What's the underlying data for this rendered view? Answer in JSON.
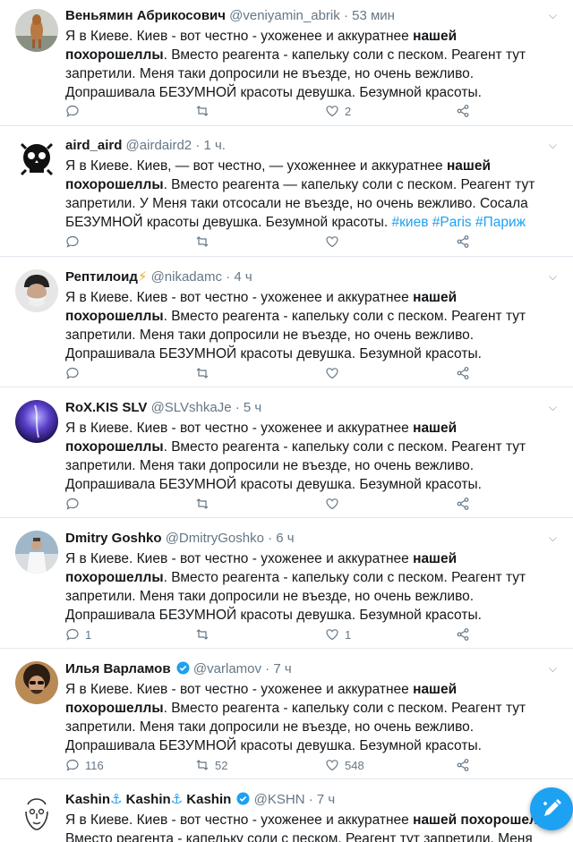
{
  "colors": {
    "accent": "#1da1f2",
    "text": "#14171a",
    "muted": "#657786",
    "divider": "#e1e8ed"
  },
  "tweets": [
    {
      "name": "Веньямин Абрикосович",
      "handle": "@veniyamin_abrik",
      "time": "53 мин",
      "avatar": "dog-avatar",
      "t1": "Я в Киеве. Киев - вот честно - ухоженее и аккуратнее ",
      "t1b": "нашей похорошеллы",
      "t1c": ".",
      "t2": "Вместо реагента - капельку соли с песком. Реагент тут запретили. Меня таки допросили не въезде, но очень вежливо. Допрашивала БЕЗУМНОЙ красоты девушка. Безумной красоты.",
      "replies": "",
      "retweets": "",
      "likes": "2"
    },
    {
      "name": "aird_aird",
      "handle": "@airdaird2",
      "time": "1 ч.",
      "avatar": "skull-avatar",
      "t1": "Я в Киеве. Киев, — вот честно, — ухоженнее и аккуратнее ",
      "t1b": "нашей похорошеллы",
      "t1c": ".",
      "t2": " Вместо реагента — капельку соли с песком. Реагент тут запретили. У Меня таки отсосали не въезде, но очень вежливо. Сосала БЕЗУМНОЙ красоты девушка. Безумной красоты. ",
      "hashtags": "#киев #Paris #Париж",
      "replies": "",
      "retweets": "",
      "likes": ""
    },
    {
      "name": "Рептилоид",
      "emoji": "⚡",
      "handle": "@nikadamc",
      "time": "4 ч",
      "avatar": "bearded-man-avatar",
      "t1": "Я в Киеве. Киев - вот честно - ухоженее и аккуратнее ",
      "t1b": "нашей похорошеллы",
      "t1c": ".",
      "t2": "Вместо реагента - капельку соли с песком. Реагент тут запретили. Меня таки допросили не въезде, но очень вежливо. Допрашивала БЕЗУМНОЙ красоты девушка. Безумной красоты.",
      "replies": "",
      "retweets": "",
      "likes": ""
    },
    {
      "name": "RoX.KIS SLV",
      "handle": "@SLVshkaJe",
      "time": "5 ч",
      "avatar": "purple-avatar",
      "t1": "Я в Киеве. Киев - вот честно - ухоженее и аккуратнее ",
      "t1b": "нашей похорошеллы",
      "t1c": ".",
      "t2": "Вместо реагента - капельку соли с песком. Реагент тут запретили. Меня таки допросили не въезде, но очень вежливо. Допрашивала БЕЗУМНОЙ красоты девушка. Безумной красоты.",
      "replies": "",
      "retweets": "",
      "likes": ""
    },
    {
      "name": "Dmitry Goshko",
      "handle": "@DmitryGoshko",
      "time": "6 ч",
      "avatar": "man-white-shirt-avatar",
      "t1": "Я в Киеве. Киев - вот честно - ухоженее и аккуратнее ",
      "t1b": "нашей похорошеллы",
      "t1c": ".",
      "t2": "Вместо реагента - капельку соли с песком. Реагент тут запретили. Меня таки допросили не въезде, но очень вежливо. Допрашивала БЕЗУМНОЙ красоты девушка. Безумной красоты.",
      "replies": "1",
      "retweets": "",
      "likes": "1"
    },
    {
      "name": "Илья Варламов",
      "verified": true,
      "handle": "@varlamov",
      "time": "7 ч",
      "avatar": "curly-man-avatar",
      "t1": "Я в Киеве. Киев - вот честно - ухоженее и аккуратнее ",
      "t1b": "нашей похорошеллы",
      "t1c": ".",
      "t2": "Вместо реагента - капельку соли с песком. Реагент тут запретили. Меня таки допросили не въезде, но очень вежливо. Допрашивала БЕЗУМНОЙ красоты девушка. Безумной красоты.",
      "replies": "116",
      "retweets": "52",
      "likes": "548"
    },
    {
      "name": "Kashin",
      "anchor": "⚓",
      "handle": "@KSHN",
      "time": "7 ч",
      "avatar": "sketch-face-avatar",
      "t1": "Я в Киеве. Киев - вот честно - ухоженее и аккуратнее ",
      "t1b": "нашей похорошел",
      "t1c": "",
      "t2": "Вместо реагента - капельку соли с песком. Реагент тут запретили. Меня",
      "replies": "",
      "retweets": "",
      "likes": ""
    }
  ],
  "fab": {
    "icon": "compose-tweet-icon"
  }
}
